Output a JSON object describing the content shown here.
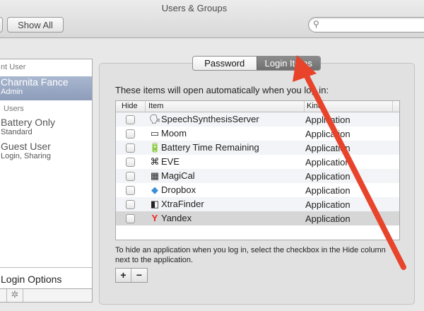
{
  "window": {
    "title": "Users & Groups"
  },
  "toolbar": {
    "show_all": "Show All",
    "search_placeholder": ""
  },
  "sidebar": {
    "current_user_header": "nt User",
    "current_user": {
      "name": "Charnita Fance",
      "role": "Admin"
    },
    "other_users_header": "Users",
    "users": [
      {
        "name": "Battery Only",
        "role": "Standard"
      },
      {
        "name": "Guest User",
        "role": "Login, Sharing"
      }
    ],
    "login_options": "Login Options"
  },
  "tabs": [
    {
      "label": "Password",
      "active": false
    },
    {
      "label": "Login Items",
      "active": true
    }
  ],
  "main": {
    "intro": "These items will open automatically when you log in:",
    "columns": [
      "Hide",
      "Item",
      "Kind"
    ],
    "items": [
      {
        "name": "SpeechSynthesisServer",
        "kind": "Application",
        "icon": "speech-icon",
        "glyph": "🗣",
        "hide": false
      },
      {
        "name": "Moom",
        "kind": "Application",
        "icon": "moom-icon",
        "glyph": "▭",
        "hide": false
      },
      {
        "name": "Battery Time Remaining",
        "kind": "Application",
        "icon": "battery-icon",
        "glyph": "🔋",
        "hide": false
      },
      {
        "name": "EVE",
        "kind": "Application",
        "icon": "command-icon",
        "glyph": "⌘",
        "hide": false
      },
      {
        "name": "MagiCal",
        "kind": "Application",
        "icon": "calendar-icon",
        "glyph": "▦",
        "hide": false
      },
      {
        "name": "Dropbox",
        "kind": "Application",
        "icon": "dropbox-icon",
        "glyph": "◆",
        "hide": false
      },
      {
        "name": "XtraFinder",
        "kind": "Application",
        "icon": "finder-icon",
        "glyph": "◧",
        "hide": false
      },
      {
        "name": "Yandex",
        "kind": "Application",
        "icon": "yandex-icon",
        "glyph": "Y",
        "hide": false
      }
    ],
    "help": "To hide an application when you log in, select the checkbox in the Hide column next to the application.",
    "add": "+",
    "remove": "−"
  },
  "colors": {
    "arrow": "#e8432b",
    "selection": "#9aa9c5"
  }
}
